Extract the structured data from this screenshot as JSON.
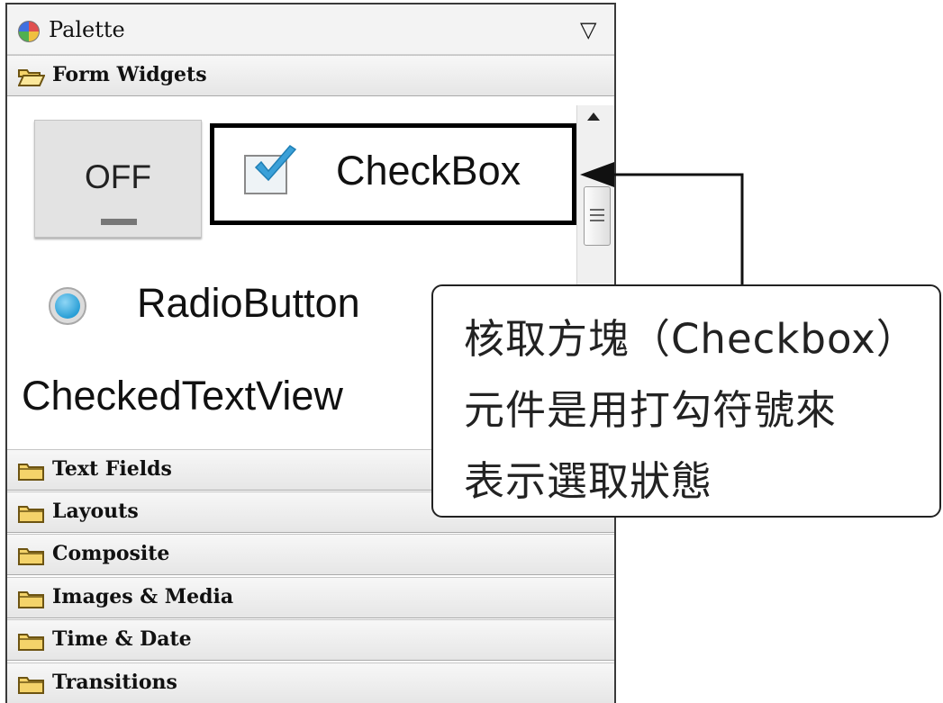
{
  "palette": {
    "title": "Palette",
    "menu_icon": "triangle-down",
    "palette_icon": "palette-icon"
  },
  "drawers": {
    "form_widgets": "Form Widgets",
    "text_fields": "Text Fields",
    "layouts": "Layouts",
    "composite": "Composite",
    "images_media": "Images & Media",
    "time_date": "Time & Date",
    "transitions": "Transitions"
  },
  "widgets": {
    "toggle_label": "OFF",
    "checkbox_label": "CheckBox",
    "checkbox_checked": true,
    "radio_label": "RadioButton",
    "checked_text_view_label": "CheckedTextView"
  },
  "callout": {
    "line1": "核取方塊（Checkbox）",
    "line2": "元件是用打勾符號來",
    "line3": "表示選取狀態"
  },
  "colors": {
    "checkmark": "#3aa0d8",
    "radio_fill": "#2a9fd6",
    "folder": "#f4d36a"
  }
}
